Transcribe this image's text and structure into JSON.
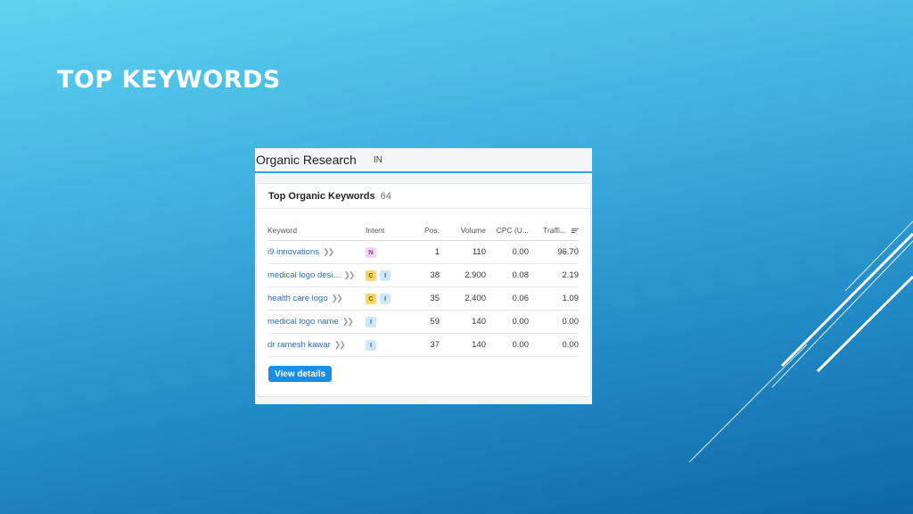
{
  "slide": {
    "title": "TOP KEYWORDS"
  },
  "app": {
    "title": "Organic Research",
    "region": "IN"
  },
  "card": {
    "title": "Top Organic Keywords",
    "count": "64"
  },
  "table": {
    "headers": {
      "keyword": "Keyword",
      "intent": "Intent",
      "pos": "Pos.",
      "volume": "Volume",
      "cpc": "CPC (U...",
      "traffic": "Traffi..."
    },
    "rows": [
      {
        "keyword": "i9 innovations",
        "intents": [
          "N"
        ],
        "pos": "1",
        "volume": "110",
        "cpc": "0.00",
        "traffic": "96.70"
      },
      {
        "keyword": "medical logo desi...",
        "intents": [
          "C",
          "I"
        ],
        "pos": "38",
        "volume": "2,900",
        "cpc": "0.08",
        "traffic": "2.19"
      },
      {
        "keyword": "health care logo",
        "intents": [
          "C",
          "I"
        ],
        "pos": "35",
        "volume": "2,400",
        "cpc": "0.06",
        "traffic": "1.09"
      },
      {
        "keyword": "medical logo name",
        "intents": [
          "I"
        ],
        "pos": "59",
        "volume": "140",
        "cpc": "0.00",
        "traffic": "0.00"
      },
      {
        "keyword": "dr ramesh kawar",
        "intents": [
          "I"
        ],
        "pos": "37",
        "volume": "140",
        "cpc": "0.00",
        "traffic": "0.00"
      }
    ]
  },
  "actions": {
    "view_details": "View details"
  },
  "colors": {
    "intent_N_bg": "#f1d4f7",
    "intent_N_fg": "#8a3ca0",
    "intent_C_bg": "#fcd66b",
    "intent_C_fg": "#7a5a00",
    "intent_I_bg": "#cfe6fb",
    "intent_I_fg": "#2a6cb0",
    "accent": "#1a8de8"
  },
  "icons": {
    "keyword_link": "double-chevron-right-icon",
    "sort": "sort-lines-icon"
  }
}
